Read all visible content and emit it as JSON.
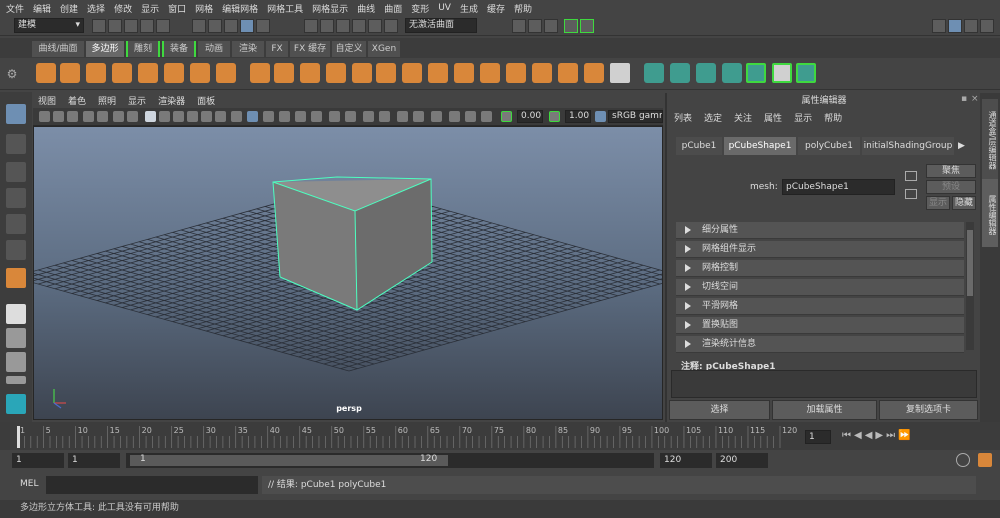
{
  "menubar": [
    "文件",
    "编辑",
    "创建",
    "选择",
    "修改",
    "显示",
    "窗口",
    "网格",
    "编辑网格",
    "网格工具",
    "网格显示",
    "曲线",
    "曲面",
    "变形",
    "UV",
    "生成",
    "缓存",
    "帮助"
  ],
  "status": {
    "mode": "建模",
    "render_layer": "无激活曲面"
  },
  "shelf_tabs": [
    "曲线/曲面",
    "多边形",
    "雕刻",
    "装备",
    "动画",
    "渲染",
    "FX",
    "FX 缓存",
    "自定义",
    "XGen"
  ],
  "shelf_active": "多边形",
  "viewport": {
    "menu": [
      "视图",
      "着色",
      "照明",
      "显示",
      "渲染器",
      "面板"
    ],
    "exposure": "0.00",
    "gamma": "1.00",
    "color_space": "sRGB gamm",
    "camera": "persp"
  },
  "attr": {
    "header": "属性编辑器",
    "menu": [
      "列表",
      "选定",
      "关注",
      "属性",
      "显示",
      "帮助"
    ],
    "tabs": [
      "pCube1",
      "pCubeShape1",
      "polyCube1",
      "initialShadingGroup"
    ],
    "active_tab": "pCubeShape1",
    "mesh_label": "mesh:",
    "mesh_value": "pCubeShape1",
    "focus": "聚焦",
    "preset": "预设",
    "show": "显示",
    "hide": "隐藏",
    "sections": [
      "细分属性",
      "网格组件显示",
      "网格控制",
      "切线空间",
      "平滑网格",
      "置换贴图",
      "渲染统计信息"
    ],
    "notes_label": "注释:",
    "notes_value": "pCubeShape1",
    "select": "选择",
    "load_attrs": "加载属性",
    "copy_tab": "复制选项卡"
  },
  "side_tabs": [
    "通道盒/层编辑器",
    "属性编辑器"
  ],
  "timeline": {
    "ticks": [
      "1",
      "5",
      "10",
      "15",
      "20",
      "25",
      "30",
      "35",
      "40",
      "45",
      "50",
      "55",
      "60",
      "65",
      "70",
      "75",
      "80",
      "85",
      "90",
      "95",
      "100",
      "105",
      "110",
      "115",
      "120"
    ],
    "current": "1"
  },
  "range": {
    "start": "1",
    "start2": "1",
    "slider_start": "1",
    "slider_end": "120",
    "end": "120",
    "end2": "200"
  },
  "cmd": {
    "lang": "MEL",
    "result": "// 结果: pCube1 polyCube1"
  },
  "help": "多边形立方体工具: 此工具没有可用帮助"
}
